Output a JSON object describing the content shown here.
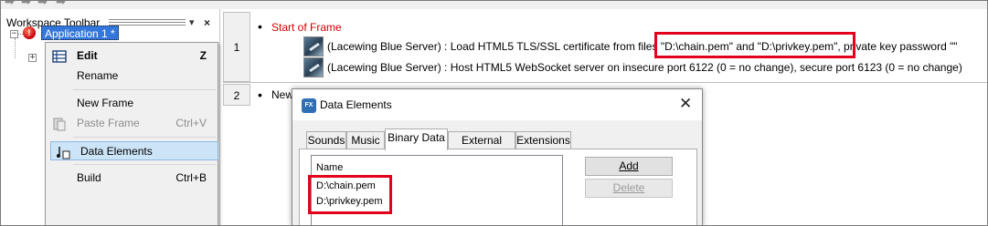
{
  "workspace": {
    "title": "Workspace Toolbar",
    "tree": {
      "app_label": "Application 1 *"
    }
  },
  "context_menu": {
    "items": [
      {
        "label": "Edit",
        "shortcut": "Z",
        "bold": true,
        "icon": "grid-icon"
      },
      {
        "label": "Rename",
        "shortcut": ""
      },
      {
        "label": "New Frame",
        "shortcut": ""
      },
      {
        "label": "Paste Frame",
        "shortcut": "Ctrl+V",
        "disabled": true,
        "icon": "paste-icon"
      },
      {
        "label": "Data Elements",
        "shortcut": "",
        "selected": true,
        "icon": "music-note-icon"
      },
      {
        "label": "Build",
        "shortcut": "Ctrl+B"
      }
    ]
  },
  "frames": [
    {
      "number": "1",
      "title": "Start of Frame",
      "actions": [
        "(Lacewing Blue Server) : Load HTML5 TLS/SSL certificate from files \"D:\\chain.pem\" and \"D:\\privkey.pem\", private key password \"\"",
        "(Lacewing Blue Server) : Host HTML5 WebSocket server on insecure port 6122 (0 = no change), secure port 6123 (0 = no change)"
      ]
    },
    {
      "number": "2",
      "title": "New"
    }
  ],
  "dialog": {
    "title": "Data Elements",
    "tabs": [
      "Sounds",
      "Music",
      "Binary Data",
      "External Files",
      "Extensions"
    ],
    "active_tab": "Binary Data",
    "list_header": "Name",
    "items": [
      "D:\\chain.pem",
      "D:\\privkey.pem"
    ],
    "buttons": {
      "add": "Add",
      "delete": "Delete"
    }
  },
  "colors": {
    "highlight": "#e3001b",
    "frame_title": "#d40000",
    "selection": "#3377dd"
  }
}
